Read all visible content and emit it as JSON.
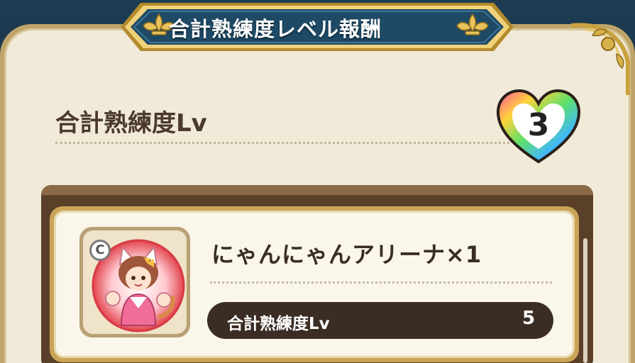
{
  "dialog": {
    "title": "合計熟練度レベル報酬"
  },
  "summary": {
    "label": "合計熟練度Lv",
    "level": "3"
  },
  "rewards": [
    {
      "name": "にゃんにゃんアリーナ×1",
      "rarity": "C",
      "requirement_label": "合計熟練度Lv",
      "requirement_value": "5"
    }
  ],
  "colors": {
    "parchment": "#f1ead8",
    "banner_navy": "#1f4a66",
    "gold": "#d6ad45",
    "pill_dark": "#3b2d24",
    "text_brown": "#4b3a2c"
  },
  "icons": {
    "banner_ornament": "fleur-de-lis-icon",
    "level_badge": "rainbow-heart-icon",
    "rarity": "rarity-c-badge-icon"
  }
}
